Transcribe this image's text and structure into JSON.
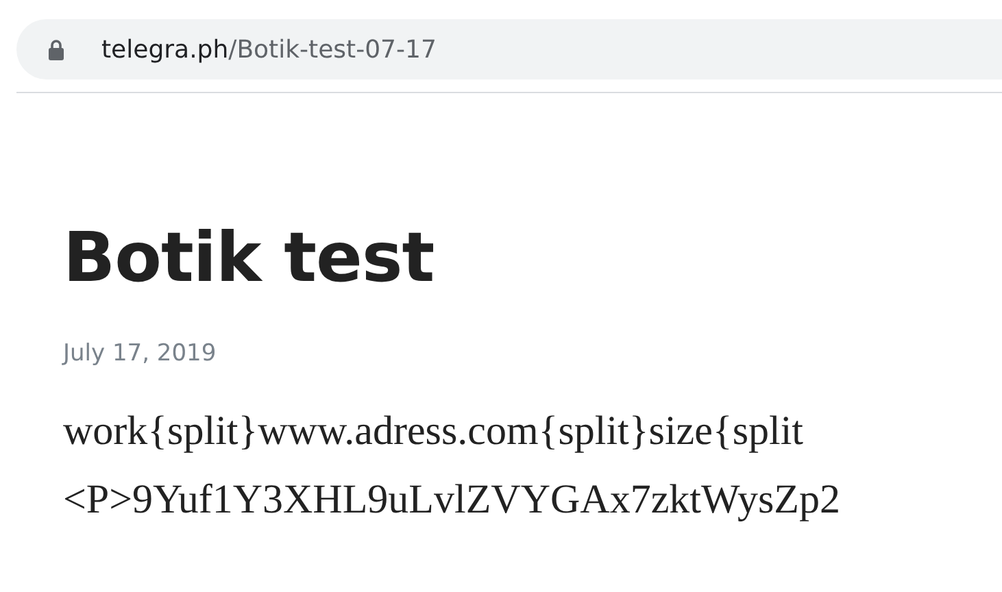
{
  "address_bar": {
    "domain": "telegra.ph",
    "path": "/Botik-test-07-17"
  },
  "article": {
    "title": "Botik test",
    "date": "July 17, 2019",
    "lines": [
      "work{split}www.adress.com{split}size{split",
      "<P>9Yuf1Y3XHL9uLvlZVYGAx7zktWysZp2"
    ]
  }
}
